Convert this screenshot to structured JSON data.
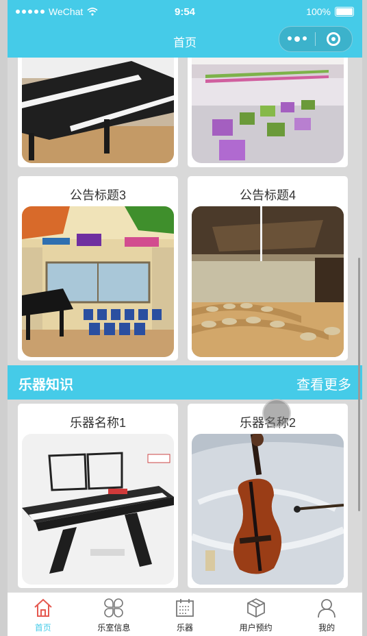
{
  "status_bar": {
    "carrier": "WeChat",
    "time": "9:54",
    "battery": "100%"
  },
  "nav": {
    "title": "首页"
  },
  "notices": {
    "items": [
      {
        "title": "公告标题3",
        "image": "music-classroom-piano-photo"
      },
      {
        "title": "公告标题4",
        "image": "wooden-auditorium-photo"
      }
    ]
  },
  "instruments": {
    "section_title": "乐器知识",
    "more_label": "查看更多",
    "items": [
      {
        "title": "乐器名称1",
        "image": "yamaha-keyboard-photo"
      },
      {
        "title": "乐器名称2",
        "image": "violin-in-case-photo"
      }
    ]
  },
  "tabs": [
    {
      "label": "首页",
      "icon": "home-icon",
      "active": true
    },
    {
      "label": "乐室信息",
      "icon": "clover-grid-icon",
      "active": false
    },
    {
      "label": "乐器",
      "icon": "calendar-icon",
      "active": false
    },
    {
      "label": "用户预约",
      "icon": "box-icon",
      "active": false
    },
    {
      "label": "我的",
      "icon": "user-icon",
      "active": false
    }
  ],
  "colors": {
    "accent": "#45cbe8",
    "active_tab_icon": "#e5584f"
  }
}
